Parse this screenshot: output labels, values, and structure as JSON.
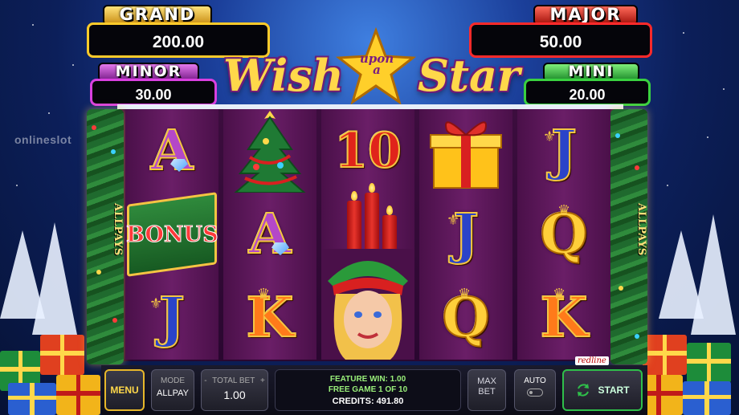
{
  "watermark": "onlineslot",
  "jackpots": {
    "grand": {
      "label": "GRAND",
      "value": "200.00"
    },
    "major": {
      "label": "MAJOR",
      "value": "50.00"
    },
    "minor": {
      "label": "MINOR",
      "value": "30.00"
    },
    "mini": {
      "label": "MINI",
      "value": "20.00"
    }
  },
  "logo": {
    "word1": "Wish",
    "word2": "upon a",
    "word3": "Star"
  },
  "side_label": "ALLPAYS",
  "reels": [
    [
      "A",
      "BONUS",
      "J"
    ],
    [
      "tree",
      "A",
      "K"
    ],
    [
      "10",
      "candles",
      "elf"
    ],
    [
      "gift",
      "J",
      "Q"
    ],
    [
      "J",
      "Q",
      "K"
    ]
  ],
  "bonus_symbol": "BONUS",
  "brand_badge": "redline",
  "controls": {
    "menu": "MENU",
    "mode_label": "MODE",
    "mode_value": "ALLPAY",
    "total_bet_label": "TOTAL BET",
    "total_bet_value": "1.00",
    "minus": "-",
    "plus": "+",
    "feature_win": "FEATURE WIN: 1.00",
    "free_game": "FREE GAME 1 OF 10",
    "credits": "CREDITS: 491.80",
    "max_bet_1": "MAX",
    "max_bet_2": "BET",
    "auto": "AUTO",
    "start": "START"
  }
}
